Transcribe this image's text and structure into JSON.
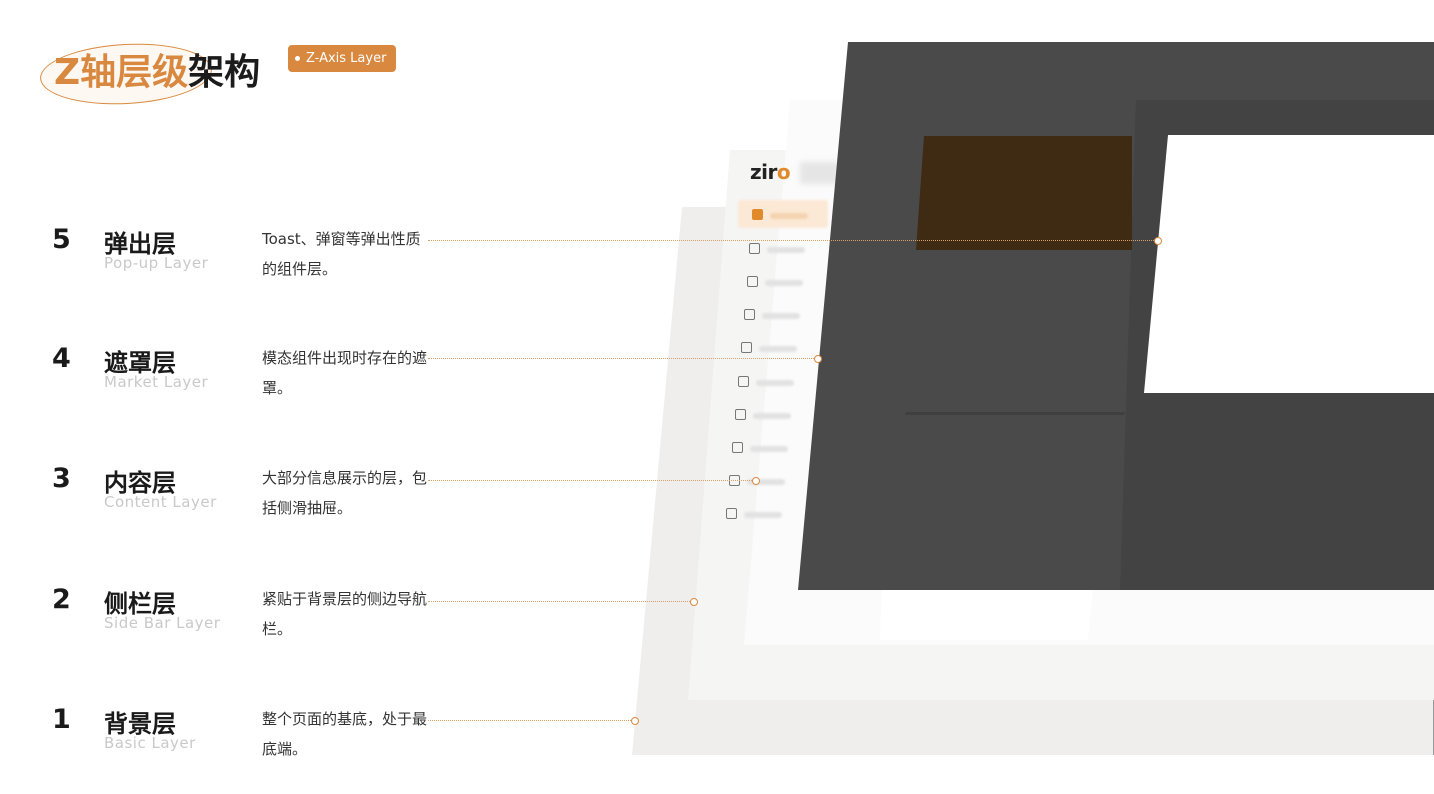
{
  "header": {
    "title_accent": "Z轴层级",
    "title_rest": "架构",
    "tag": "Z-Axis Layer"
  },
  "layers": [
    {
      "num": "5",
      "name": "弹出层",
      "en": "Pop-up Layer",
      "desc": "Toast、弹窗等弹出性质的组件层。"
    },
    {
      "num": "4",
      "name": "遮罩层",
      "en": "Market Layer",
      "desc": "模态组件出现时存在的遮罩。"
    },
    {
      "num": "3",
      "name": "内容层",
      "en": "Content Layer",
      "desc": "大部分信息展示的层，包括侧滑抽屉。"
    },
    {
      "num": "2",
      "name": "侧栏层",
      "en": "Side Bar Layer",
      "desc": "紧贴于背景层的侧边导航栏。"
    },
    {
      "num": "1",
      "name": "背景层",
      "en": "Basic Layer",
      "desc": "整个页面的基底，处于最底端。"
    }
  ],
  "illustration": {
    "logo_main": "zir",
    "logo_accent": "o",
    "colors": {
      "accent": "#d9893f",
      "mask": "#4a4a4a",
      "popup": "#3f2a14"
    }
  }
}
